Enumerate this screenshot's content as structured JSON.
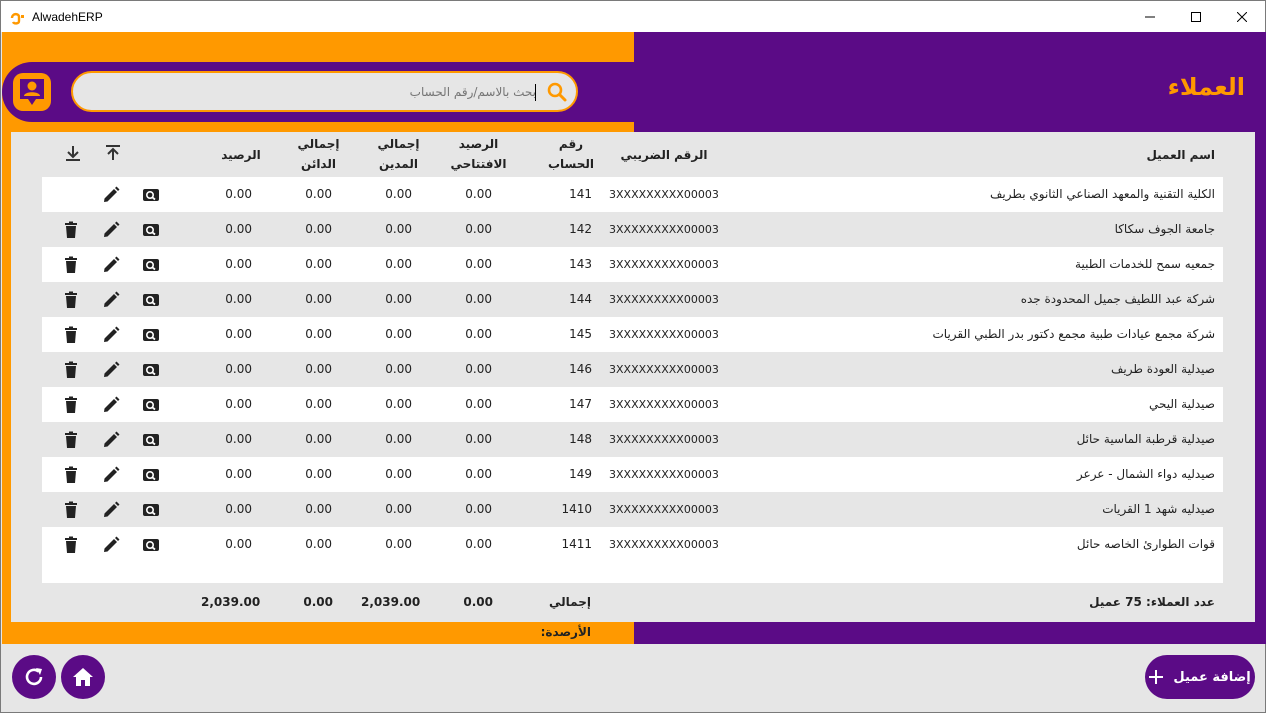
{
  "window": {
    "title": "AlwadehERP"
  },
  "colors": {
    "orange": "#ff9900",
    "purple": "#5b0b86",
    "background": "#e6e6e6"
  },
  "page": {
    "title": "العملاء"
  },
  "search": {
    "placeholder": "بحث بالاسم/رقم الحساب"
  },
  "table": {
    "headers": {
      "name": "اسم العميل",
      "tax": "الرقم الضريبي",
      "account": "رقم الحساب",
      "opening": "الرصيد الافتتاحي",
      "debit": "إجمالي المدين",
      "credit": "إجمالي الدائن",
      "balance": "الرصيد"
    },
    "rows": [
      {
        "name": "الكلية التقنية والمعهد الصناعي الثانوي بطريف",
        "tax": "3XXXXXXXXX00003",
        "account": "141",
        "opening": "0.00",
        "debit": "0.00",
        "credit": "0.00",
        "balance": "0.00",
        "can_delete": false
      },
      {
        "name": "جامعة الجوف سكاكا",
        "tax": "3XXXXXXXXX00003",
        "account": "142",
        "opening": "0.00",
        "debit": "0.00",
        "credit": "0.00",
        "balance": "0.00",
        "can_delete": true
      },
      {
        "name": "جمعيه سمح للخدمات الطبية",
        "tax": "3XXXXXXXXX00003",
        "account": "143",
        "opening": "0.00",
        "debit": "0.00",
        "credit": "0.00",
        "balance": "0.00",
        "can_delete": true
      },
      {
        "name": "شركة عبد اللطيف جميل المحدودة جده",
        "tax": "3XXXXXXXXX00003",
        "account": "144",
        "opening": "0.00",
        "debit": "0.00",
        "credit": "0.00",
        "balance": "0.00",
        "can_delete": true
      },
      {
        "name": "شركة مجمع عيادات طبية مجمع دكتور بدر الطبي القريات",
        "tax": "3XXXXXXXXX00003",
        "account": "145",
        "opening": "0.00",
        "debit": "0.00",
        "credit": "0.00",
        "balance": "0.00",
        "can_delete": true
      },
      {
        "name": "صيدلية العودة طريف",
        "tax": "3XXXXXXXXX00003",
        "account": "146",
        "opening": "0.00",
        "debit": "0.00",
        "credit": "0.00",
        "balance": "0.00",
        "can_delete": true
      },
      {
        "name": "صيدلية اليحي",
        "tax": "3XXXXXXXXX00003",
        "account": "147",
        "opening": "0.00",
        "debit": "0.00",
        "credit": "0.00",
        "balance": "0.00",
        "can_delete": true
      },
      {
        "name": "صيدلية قرطبة الماسية حائل",
        "tax": "3XXXXXXXXX00003",
        "account": "148",
        "opening": "0.00",
        "debit": "0.00",
        "credit": "0.00",
        "balance": "0.00",
        "can_delete": true
      },
      {
        "name": "صيدليه دواء الشمال - عرعر",
        "tax": "3XXXXXXXXX00003",
        "account": "149",
        "opening": "0.00",
        "debit": "0.00",
        "credit": "0.00",
        "balance": "0.00",
        "can_delete": true
      },
      {
        "name": "صيدليه شهد 1 القريات",
        "tax": "3XXXXXXXXX00003",
        "account": "1410",
        "opening": "0.00",
        "debit": "0.00",
        "credit": "0.00",
        "balance": "0.00",
        "can_delete": true
      },
      {
        "name": "قوات الطوارئ الخاصه حائل",
        "tax": "3XXXXXXXXX00003",
        "account": "1411",
        "opening": "0.00",
        "debit": "0.00",
        "credit": "0.00",
        "balance": "0.00",
        "can_delete": true
      }
    ],
    "footer": {
      "count": "عدد العملاء: 75 عميل",
      "totals_label": "إجمالي الأرصدة:",
      "opening": "0.00",
      "debit": "2,039.00",
      "credit": "0.00",
      "balance": "2,039.00"
    }
  },
  "actions": {
    "add_customer": "إضافة عميل"
  },
  "icons": {
    "upload": "upload-icon",
    "download": "download-icon",
    "view": "zoom-view-icon",
    "edit": "pencil-icon",
    "delete": "trash-icon",
    "refresh": "refresh-icon",
    "home": "home-icon",
    "add": "plus-icon",
    "user": "user-icon",
    "search": "search-icon"
  }
}
